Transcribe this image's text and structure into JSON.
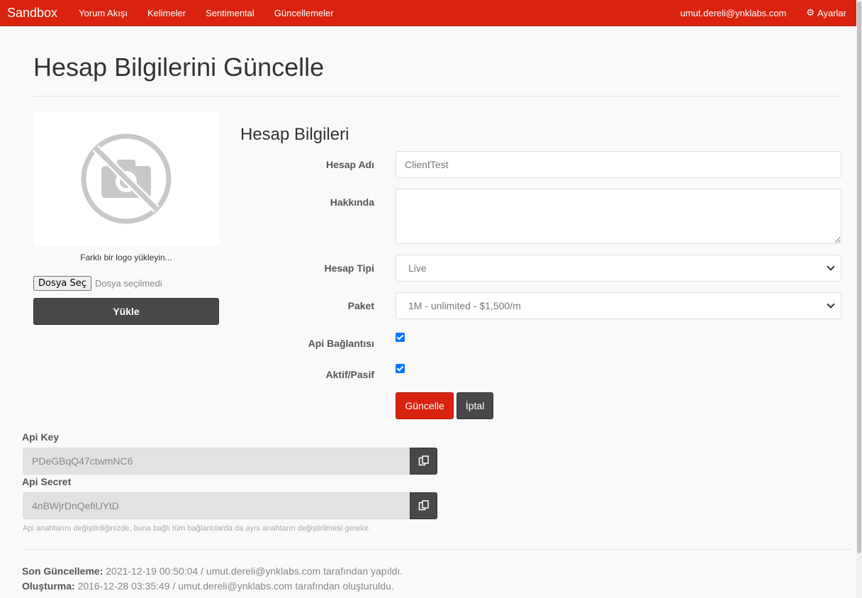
{
  "navbar": {
    "brand": "Sandbox",
    "links": [
      "Yorum Akışı",
      "Kelimeler",
      "Sentimental",
      "Güncellemeler"
    ],
    "email": "umut.dereli@ynklabs.com",
    "settings": "Ayarlar"
  },
  "page": {
    "title": "Hesap Bilgilerini Güncelle"
  },
  "logo": {
    "hint": "Farklı bir logo yükleyin...",
    "file_button": "Dosya Seç",
    "file_status": "Dosya seçilmedi",
    "upload_button": "Yükle"
  },
  "form": {
    "section_title": "Hesap Bilgileri",
    "account_name_label": "Hesap Adı",
    "account_name_value": "ClientTest",
    "about_label": "Hakkında",
    "about_value": "",
    "account_type_label": "Hesap Tipi",
    "account_type_value": "Live",
    "package_label": "Paket",
    "package_value": "1M - unlimited - $1,500/m",
    "api_connection_label": "Api Bağlantısı",
    "api_connection_checked": true,
    "active_label": "Aktif/Pasif",
    "active_checked": true,
    "update_button": "Güncelle",
    "cancel_button": "İptal"
  },
  "api": {
    "key_label": "Api Key",
    "key_value": "PDeGBqQ47ctwmNC6",
    "secret_label": "Api Secret",
    "secret_value": "4nBWjrDnQefiUYtD",
    "help": "Api anahtarını değiştirdiğinizde, buna bağlı tüm bağlantılarda da aynı anahtarın değiştirilmesi gerekir."
  },
  "meta": {
    "updated_label": "Son Güncelleme:",
    "updated_text": "2021-12-19 00:50:04 / umut.dereli@ynklabs.com tarafından yapıldı.",
    "created_label": "Oluşturma:",
    "created_text": "2016-12-28 03:35:49 / umut.dereli@ynklabs.com tarafından oluşturuldu."
  },
  "colors": {
    "brand": "#d9230f",
    "dark_button": "#474949",
    "checkbox": "#0075ff"
  }
}
